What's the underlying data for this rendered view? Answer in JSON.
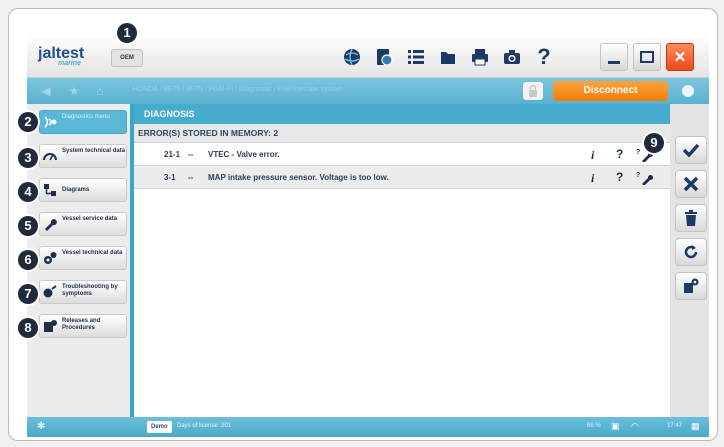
{
  "app": {
    "logo": "jaltest",
    "logo_sub": "marine",
    "oem_chip": "OEM"
  },
  "toolbar": {
    "icons": [
      "globe-icon",
      "camera-document-icon",
      "list-icon",
      "folder-icon",
      "printer-icon",
      "photo-camera-icon",
      "help-icon"
    ],
    "help_label": "?"
  },
  "window": {
    "minimize": "_",
    "maximize": "□",
    "close": "✕"
  },
  "navstrip": {
    "crumbs": "... HONDA / BF75 / BF75 / PGM-FI / Diagnostic / Fuel injection system",
    "disconnect_label": "Disconnect"
  },
  "sidebar": {
    "items": [
      {
        "label": "Diagnostics menu",
        "icon": "diagnosis-icon"
      },
      {
        "label": "System technical data",
        "icon": "gauge-icon"
      },
      {
        "label": "Diagrams",
        "icon": "diagram-icon"
      },
      {
        "label": "Vessel service data",
        "icon": "wrench-icon"
      },
      {
        "label": "Vessel technical data",
        "icon": "gears-icon"
      },
      {
        "label": "Troubleshooting by symptoms",
        "icon": "troubleshoot-icon"
      },
      {
        "label": "Releases and Procedures",
        "icon": "procedures-icon"
      }
    ]
  },
  "main": {
    "title": "DIAGNOSIS",
    "errors_header": "ERROR(S) STORED IN MEMORY: 2",
    "rows": [
      {
        "code": "21-1",
        "dash": "--",
        "desc": "VTEC - Valve error."
      },
      {
        "code": "3-1",
        "dash": "--",
        "desc": "MAP intake pressure sensor. Voltage is too low."
      }
    ],
    "info_label": "i",
    "help_label": "?"
  },
  "actions": [
    "check-icon",
    "cancel-icon",
    "trash-icon",
    "refresh-icon",
    "repair-tools-icon"
  ],
  "status": {
    "bluetooth": "✱",
    "demo": "Demo",
    "days": "Days of license: 201",
    "battery": "66 %",
    "time": "17:47"
  },
  "callouts": [
    "1",
    "2",
    "3",
    "4",
    "5",
    "6",
    "7",
    "8",
    "9"
  ],
  "colors": {
    "accent": "#46abcd",
    "disconnect": "#f58a16",
    "close": "#e74a1a",
    "callout": "#1f2a3a"
  }
}
